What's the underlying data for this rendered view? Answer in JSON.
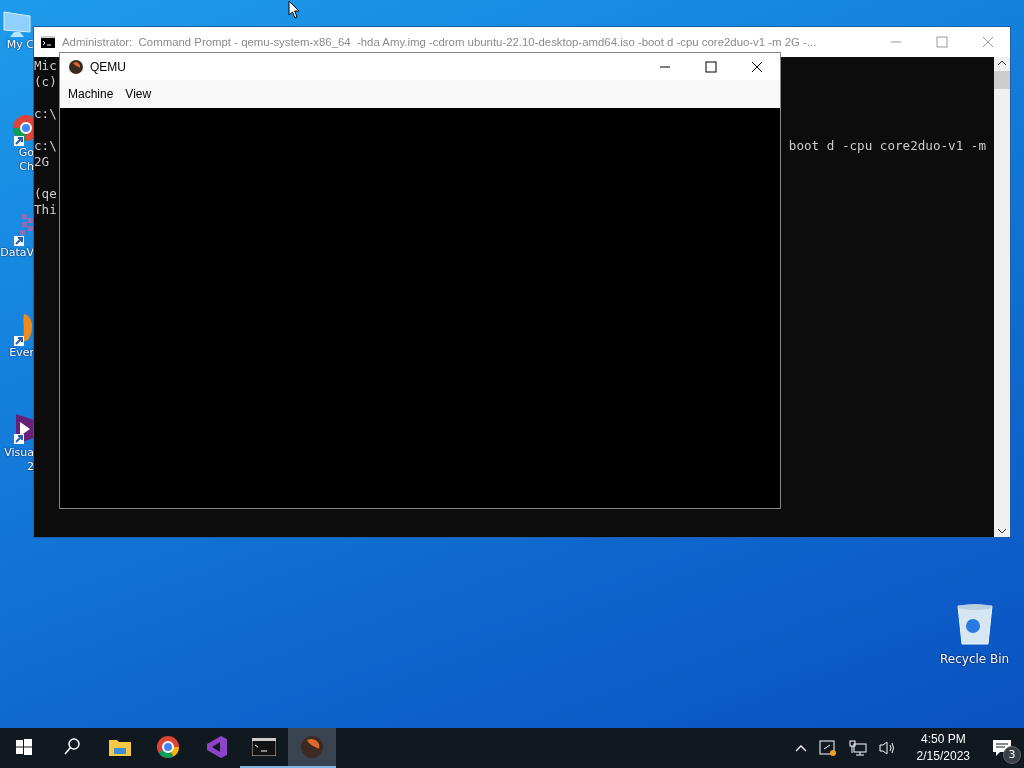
{
  "desktop_icons": [
    {
      "kind": "computer",
      "lines": [
        "My C"
      ]
    },
    {
      "kind": "chrome",
      "lines": [
        "Go",
        "Ch"
      ]
    },
    {
      "kind": "dataviz",
      "lines": [
        "DataV"
      ]
    },
    {
      "kind": "evernote",
      "lines": [
        "Ever"
      ]
    },
    {
      "kind": "visualstudio",
      "lines": [
        "Visua",
        "2"
      ]
    }
  ],
  "recycle_bin": {
    "label": "Recycle Bin"
  },
  "cmd_window": {
    "title": "Administrator:  Command Prompt - qemu-system-x86_64  -hda Amy.img -cdrom ubuntu-22.10-desktop-amd64.iso -boot d -cpu core2duo-v1 -m 2G -...",
    "lines": [
      {
        "left": "Mic",
        "spaced": false
      },
      {
        "left": "(c)",
        "spaced": false
      },
      {
        "left": "c:\\",
        "spaced": true
      },
      {
        "left": "c:\\",
        "right": "boot d -cpu core2duo-v1 -m",
        "spaced": true
      },
      {
        "left": "2G",
        "spaced": false
      },
      {
        "left": "(qe",
        "spaced": true
      },
      {
        "left": "Thi",
        "spaced": false
      }
    ]
  },
  "qemu_window": {
    "title": "QEMU",
    "menu": [
      "Machine",
      "View"
    ]
  },
  "taskbar": {
    "items": [
      {
        "kind": "start",
        "running": false,
        "selected": false
      },
      {
        "kind": "search",
        "running": false,
        "selected": false
      },
      {
        "kind": "explorer",
        "running": false,
        "selected": false
      },
      {
        "kind": "chrome",
        "running": false,
        "selected": false
      },
      {
        "kind": "visualstudio",
        "running": false,
        "selected": false
      },
      {
        "kind": "cmd",
        "running": true,
        "selected": false
      },
      {
        "kind": "qemu",
        "running": true,
        "selected": true
      }
    ],
    "time": "4:50 PM",
    "date": "2/15/2023",
    "notifications": "3"
  }
}
